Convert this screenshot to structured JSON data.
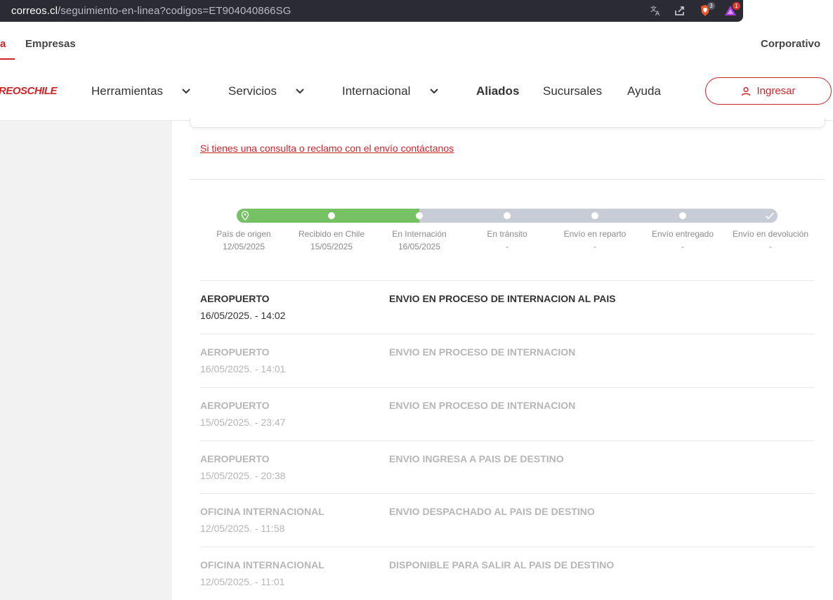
{
  "browser": {
    "url_host": "correos.cl",
    "url_path": "/seguimiento-en-linea?codigos=ET904040866SG",
    "brave_badge": "3",
    "rewards_badge": "1"
  },
  "topstrip": {
    "tab_partial": "a",
    "tab_empresas": "Empresas",
    "corporativo": "Corporativo"
  },
  "nav": {
    "logo": "REOSCHILE",
    "herramientas": "Herramientas",
    "servicios": "Servicios",
    "internacional": "Internacional",
    "aliados": "Aliados",
    "sucursales": "Sucursales",
    "ayuda": "Ayuda",
    "ingresar": "Ingresar"
  },
  "content": {
    "contact_link": "Si tienes una consulta o reclamo con el envío contáctanos"
  },
  "tracker": {
    "progress": 0.338,
    "steps": [
      {
        "label": "País de origen",
        "date": "12/05/2025"
      },
      {
        "label": "Recibido en Chile",
        "date": "15/05/2025"
      },
      {
        "label": "En Internación",
        "date": "16/05/2025"
      },
      {
        "label": "En tránsito",
        "date": "-"
      },
      {
        "label": "Envío en reparto",
        "date": "-"
      },
      {
        "label": "Envío entregado",
        "date": "-"
      },
      {
        "label": "Envío en devolución",
        "date": "-"
      }
    ]
  },
  "events": [
    {
      "place": "AEROPUERTO",
      "date": "16/05/2025. - 14:02",
      "desc": "ENVIO EN PROCESO DE INTERNACION AL PAIS"
    },
    {
      "place": "AEROPUERTO",
      "date": "16/05/2025. - 14:01",
      "desc": "ENVIO EN PROCESO DE INTERNACION"
    },
    {
      "place": "AEROPUERTO",
      "date": "15/05/2025. - 23:47",
      "desc": "ENVIO EN PROCESO DE INTERNACION"
    },
    {
      "place": "AEROPUERTO",
      "date": "15/05/2025. - 20:38",
      "desc": "ENVIO INGRESA A PAIS DE DESTINO"
    },
    {
      "place": "OFICINA INTERNACIONAL",
      "date": "12/05/2025. - 11:58",
      "desc": "ENVIO DESPACHADO AL PAIS DE DESTINO"
    },
    {
      "place": "OFICINA INTERNACIONAL",
      "date": "12/05/2025. - 11:01",
      "desc": "DISPONIBLE PARA SALIR AL PAIS DE DESTINO"
    }
  ],
  "colors": {
    "brand_red": "#d1232a",
    "progress_green": "#76c163",
    "progress_grey": "#c8ccd6"
  }
}
